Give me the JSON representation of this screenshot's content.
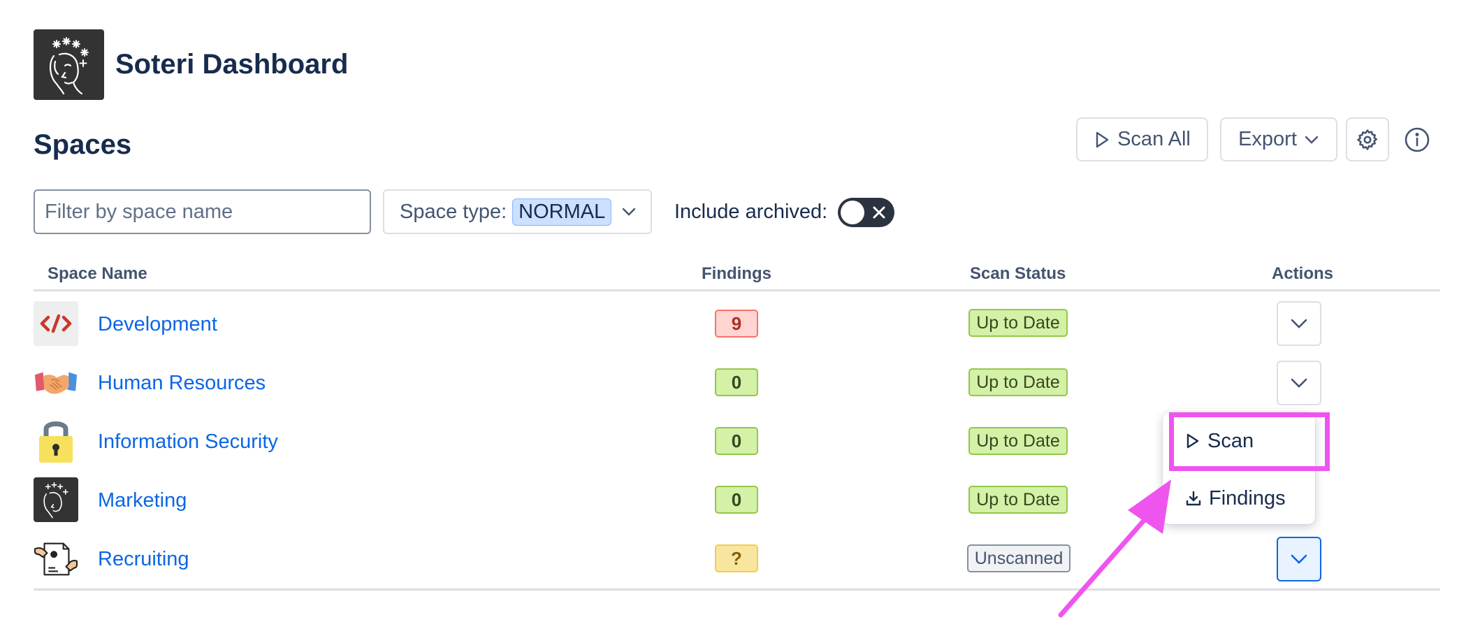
{
  "app": {
    "title": "Soteri Dashboard"
  },
  "page": {
    "title": "Spaces"
  },
  "toolbar": {
    "scan_all_label": "Scan All",
    "export_label": "Export"
  },
  "filters": {
    "search_placeholder": "Filter by space name",
    "space_type_label": "Space type:",
    "space_type_value": "NORMAL",
    "include_archived_label": "Include archived:",
    "include_archived": false
  },
  "table": {
    "headers": {
      "name": "Space Name",
      "findings": "Findings",
      "status": "Scan Status",
      "actions": "Actions"
    },
    "rows": [
      {
        "name": "Development",
        "findings": "9",
        "status": "Up to Date",
        "icon": "code-icon"
      },
      {
        "name": "Human Resources",
        "findings": "0",
        "status": "Up to Date",
        "icon": "handshake-icon"
      },
      {
        "name": "Information Security",
        "findings": "0",
        "status": "Up to Date",
        "icon": "lock-icon"
      },
      {
        "name": "Marketing",
        "findings": "0",
        "status": "Up to Date",
        "icon": "soteri-logo-icon"
      },
      {
        "name": "Recruiting",
        "findings": "?",
        "status": "Unscanned",
        "icon": "resume-icon"
      }
    ]
  },
  "actions_menu": {
    "scan_label": "Scan",
    "findings_label": "Findings"
  },
  "colors": {
    "link": "#0c66e4",
    "highlight": "#ee55ee",
    "logo_bg": "#333333"
  }
}
